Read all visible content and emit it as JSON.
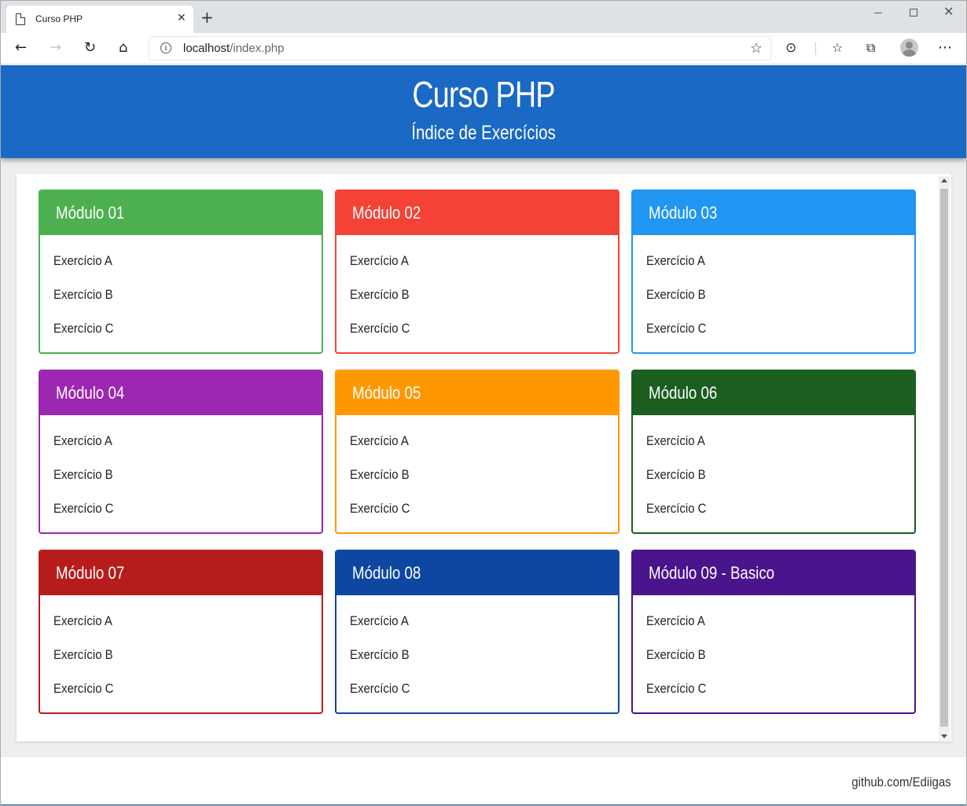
{
  "browser": {
    "tab_title": "Curso PHP",
    "tab_close": "✕",
    "new_tab": "+",
    "url_host": "localhost",
    "url_path": "/index.php"
  },
  "header": {
    "title": "Curso PHP",
    "subtitle": "Índice de Exercícios"
  },
  "modules": [
    {
      "title": "Módulo 01",
      "color": "#4caf50",
      "items": [
        "Exercício A",
        "Exercício B",
        "Exercício C"
      ]
    },
    {
      "title": "Módulo 02",
      "color": "#f44336",
      "items": [
        "Exercício A",
        "Exercício B",
        "Exercício C"
      ]
    },
    {
      "title": "Módulo 03",
      "color": "#2196f3",
      "items": [
        "Exercício A",
        "Exercício B",
        "Exercício C"
      ]
    },
    {
      "title": "Módulo 04",
      "color": "#9c27b0",
      "items": [
        "Exercício A",
        "Exercício B",
        "Exercício C"
      ]
    },
    {
      "title": "Módulo 05",
      "color": "#ff9800",
      "items": [
        "Exercício A",
        "Exercício B",
        "Exercício C"
      ]
    },
    {
      "title": "Módulo 06",
      "color": "#1b5e20",
      "items": [
        "Exercício A",
        "Exercício B",
        "Exercício C"
      ]
    },
    {
      "title": "Módulo 07",
      "color": "#b71c1c",
      "items": [
        "Exercício A",
        "Exercício B",
        "Exercício C"
      ]
    },
    {
      "title": "Módulo 08",
      "color": "#0d47a1",
      "items": [
        "Exercício A",
        "Exercício B",
        "Exercício C"
      ]
    },
    {
      "title": "Módulo 09 - Basico",
      "color": "#4a148c",
      "items": [
        "Exercício A",
        "Exercício B",
        "Exercício C"
      ]
    }
  ],
  "footer": {
    "credit": "github.com/Ediigas"
  },
  "colors": {
    "header_bg": "#1a69c4",
    "page_bg": "#eeeeee"
  }
}
